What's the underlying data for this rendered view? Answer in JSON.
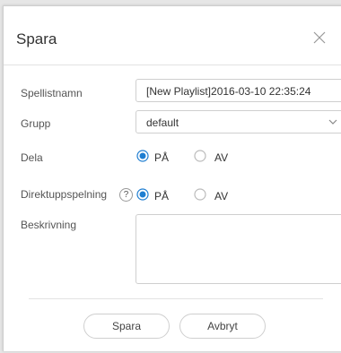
{
  "dialog": {
    "title": "Spara",
    "close_icon": "close-icon"
  },
  "form": {
    "playlist_name": {
      "label": "Spellistnamn",
      "value": "[New Playlist]2016-03-10 22:35:24"
    },
    "group": {
      "label": "Grupp",
      "value": "default",
      "icon": "chevron-down-icon"
    },
    "share": {
      "label": "Dela",
      "on_label": "PÅ",
      "off_label": "AV",
      "selected": "on"
    },
    "direct_play": {
      "label": "Direktuppspelning",
      "help": "?",
      "on_label": "PÅ",
      "off_label": "AV",
      "selected": "on"
    },
    "description": {
      "label": "Beskrivning",
      "value": ""
    }
  },
  "buttons": {
    "save": "Spara",
    "cancel": "Avbryt"
  },
  "colors": {
    "accent": "#1f7ed1",
    "border": "#cfcfcf"
  }
}
